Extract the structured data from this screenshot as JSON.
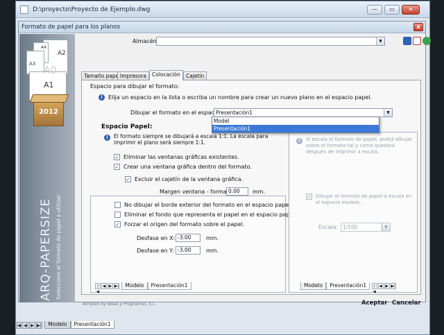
{
  "window": {
    "title": "D:\\proyecto\\Proyecto de Ejemplo.dwg",
    "minimize": "—",
    "maximize": "▭",
    "close": "✕"
  },
  "dialog": {
    "title": "Formato de papel para los planos",
    "close": "x"
  },
  "brand": {
    "sheets": [
      "A4",
      "A3",
      "A2",
      "A1",
      "A0"
    ],
    "year": "2012",
    "product": "ARQ-PAPERSIZE",
    "tagline": "Seleccione el formato de papel a utilizar"
  },
  "almacen": {
    "label": "Almacén",
    "value": ""
  },
  "tabs": [
    {
      "label": "Tamaño papel"
    },
    {
      "label": "Impresora"
    },
    {
      "label": "Colocación"
    },
    {
      "label": "Cajetín"
    }
  ],
  "panel": {
    "group_title": "Espacio para dibujar el formato:",
    "info_text": "Elija un espacio en la lista o escriba un nombre para crear un nuevo plano en el espacio papel.",
    "draw_label": "Dibujar el formato en el espacio:",
    "draw_value": "Presentación1",
    "dropdown_options": [
      "Model",
      "Presentación1"
    ],
    "space_title": "Espacio Papel:",
    "space_info": "El formato siempre se dibujará a escala 1:1. La escala para imprimir el plano será siempre 1:1.",
    "options": [
      {
        "label": "Eliminar las ventanas gráficas existentes.",
        "checked": true
      },
      {
        "label": "Crear una ventana gráfica dentro del formato.",
        "checked": true
      },
      {
        "label": "Excluir el cajetín de la ventana gráfica.",
        "checked": true
      }
    ],
    "margin_label": "Margen ventana - formato:",
    "margin_value": "0.00",
    "margin_unit": "mm.",
    "options2": [
      {
        "label": "No dibujar el borde exterior del formato en el espacio papel.",
        "checked": false
      },
      {
        "label": "Eliminar el fondo que representa el papel en el espacio papel.",
        "checked": false
      },
      {
        "label": "Forzar el origen del formato sobre el papel.",
        "checked": true
      }
    ],
    "offset_x_label": "Desfase en X:",
    "offset_x_value": "-3.00",
    "offset_y_label": "Desfase en Y:",
    "offset_y_value": "-3.00",
    "offset_unit": "mm.",
    "layout_tabs": [
      "Modelo",
      "Presentación1"
    ]
  },
  "right_panel": {
    "info": "Si escala el formato de papel, podrá dibujar sobre el formato tal y como quedará después de imprimir a escala.",
    "model_scale_label": "Dibujar el formato de papel a escala en el espacio modelo.",
    "scale_label": "Escala:",
    "scale_value": "1/100",
    "layout_tabs": [
      "Modelo",
      "Presentación1"
    ]
  },
  "footer": {
    "credit": "Allriplan by Ideas y Programas, S.L.",
    "accept": "Aceptar",
    "cancel": "Cancelar"
  },
  "bottom_tabs": [
    "Modelo",
    "Presentación1"
  ],
  "colors": {
    "accent": "#3b78d8",
    "title_bar": "#c9d8e9",
    "brand_panel": "#8c98a4"
  }
}
